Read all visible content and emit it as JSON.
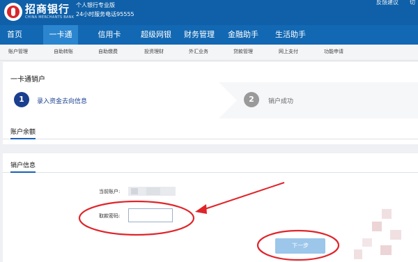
{
  "header": {
    "brand_cn": "招商银行",
    "brand_en": "CHINA MERCHANTS BANK",
    "tagline_1": "个人银行专业版",
    "tagline_2": "24小时服务电话95555",
    "feedback": "反馈建议",
    "switch": "切"
  },
  "nav": {
    "items": [
      "首页",
      "一卡通",
      "信用卡",
      "超级网银",
      "财务管理",
      "金融助手",
      "生活助手"
    ],
    "active": "一卡通"
  },
  "subnav": {
    "items": [
      "账户管理",
      "自助转账",
      "自助缴费",
      "投资理财",
      "外汇业务",
      "贷款管理",
      "网上支付",
      "功能申请"
    ]
  },
  "page": {
    "title": "一卡通销户"
  },
  "steps": [
    {
      "num": "1",
      "label": "录入资金去向信息",
      "state": "current"
    },
    {
      "num": "2",
      "label": "销户成功",
      "state": "pending"
    }
  ],
  "balance_section": {
    "title": "账户余额"
  },
  "close_section": {
    "title": "销户信息",
    "account_label": "当前账户:",
    "password_label": "取款密码:",
    "password_value": "",
    "next_button": "下一步"
  },
  "colors": {
    "header_blue": "#0f60a8",
    "nav_active": "#2b86cf",
    "step_current": "#1a3f8f",
    "annotation_red": "#e0242a",
    "button_disabled": "#9cc6ea"
  }
}
